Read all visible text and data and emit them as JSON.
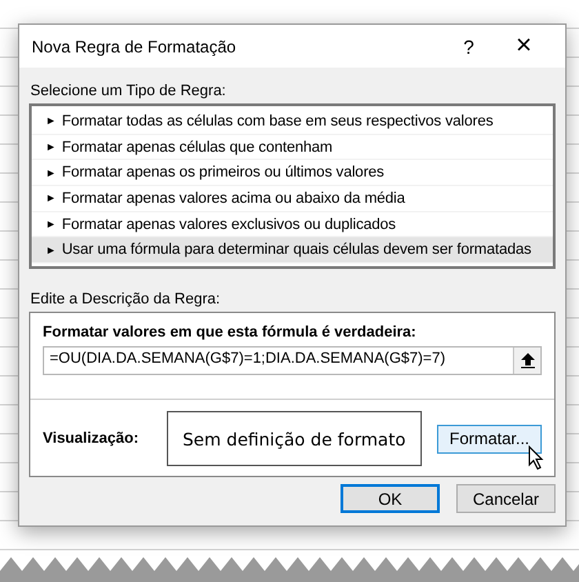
{
  "window": {
    "title": "Nova Regra de Formatação",
    "help": "?",
    "close": "×"
  },
  "rule_types": {
    "label": "Selecione um Tipo de Regra:",
    "items": [
      {
        "bullet": "►",
        "label": "Formatar todas as células com base em seus respectivos valores",
        "selected": false
      },
      {
        "bullet": "►",
        "label": "Formatar apenas células que contenham",
        "selected": false
      },
      {
        "bullet": "►",
        "label": "Formatar apenas os primeiros ou últimos valores",
        "selected": false
      },
      {
        "bullet": "►",
        "label": "Formatar apenas valores acima ou abaixo da média",
        "selected": false
      },
      {
        "bullet": "►",
        "label": "Formatar apenas valores exclusivos ou duplicados",
        "selected": false
      },
      {
        "bullet": "►",
        "label": "Usar uma fórmula para determinar quais células devem ser formatadas",
        "selected": true
      }
    ]
  },
  "description": {
    "label": "Edite a Descrição da Regra:",
    "formula_label": "Formatar valores em que esta fórmula é verdadeira:",
    "formula": "=OU(DIA.DA.SEMANA(G$7)=1;DIA.DA.SEMANA(G$7)=7)",
    "preview_label": "Visualização:",
    "preview_text": "Sem definição de formato",
    "format_button": "Formatar..."
  },
  "buttons": [
    {
      "label": "OK",
      "default": true
    },
    {
      "label": "Cancelar",
      "default": false
    }
  ]
}
